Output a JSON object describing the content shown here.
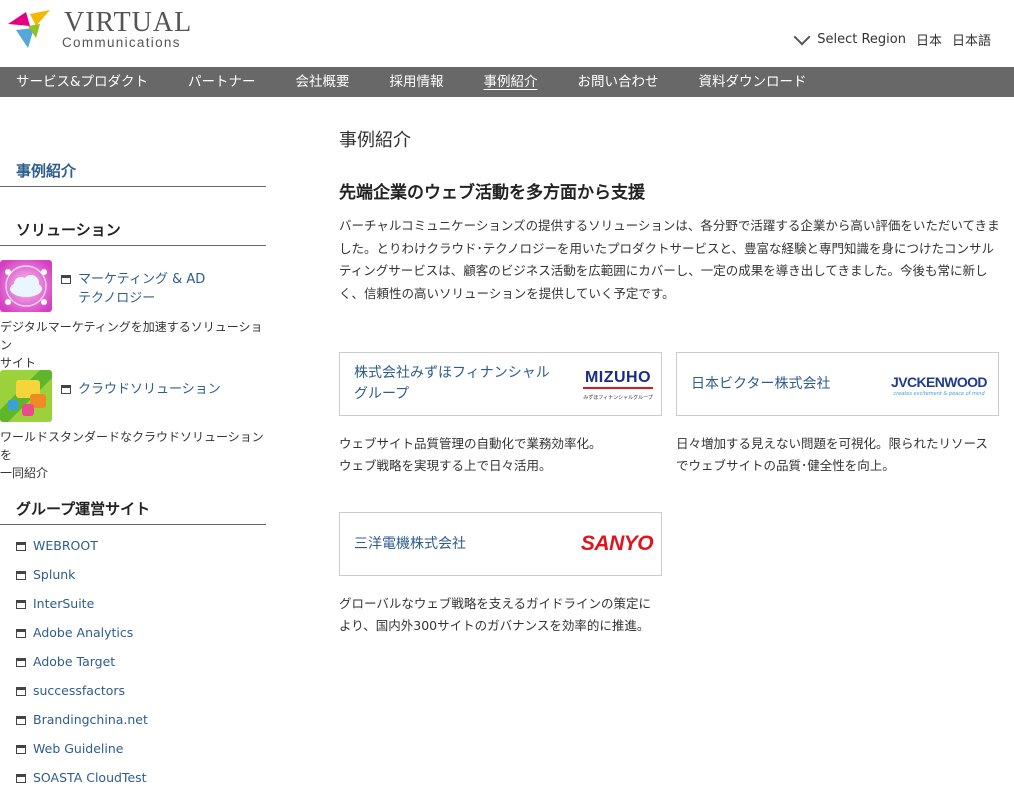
{
  "brand": {
    "name": "VIRTUAL",
    "sub": "Communications"
  },
  "region": {
    "label": "Select Region",
    "links": [
      "日本",
      "日本語"
    ]
  },
  "nav": [
    {
      "label": "サービス&プロダクト"
    },
    {
      "label": "パートナー"
    },
    {
      "label": "会社概要"
    },
    {
      "label": "採用情報"
    },
    {
      "label": "事例紹介",
      "active": true
    },
    {
      "label": "お問い合わせ"
    },
    {
      "label": "資料ダウンロード"
    }
  ],
  "sidebar": {
    "cases_heading": "事例紹介",
    "solutions_heading": "ソリューション",
    "solutions": [
      {
        "title_line1": "マーケティング & AD",
        "title_line2": "テクノロジー",
        "desc_line1": "デジタルマーケティングを加速するソリューション",
        "desc_line2": "サイト"
      },
      {
        "title_line1": "クラウドソリューション",
        "desc_line1": "ワールドスタンダードなクラウドソリューションを",
        "desc_line2": "一同紹介"
      }
    ],
    "group_heading": "グループ運営サイト",
    "group_sites": [
      "WEBROOT",
      "Splunk",
      "InterSuite",
      "Adobe Analytics",
      "Adobe Target",
      "successfactors",
      "Brandingchina.net",
      "Web Guideline",
      "SOASTA CloudTest"
    ]
  },
  "main": {
    "page_title": "事例紹介",
    "lead_title": "先端企業のウェブ活動を多方面から支援",
    "lead_text": "バーチャルコミュニケーションズの提供するソリューションは、各分野で活躍する企業から高い評価をいただいてきました。とりわけクラウド･テクノロジーを用いたプロダクトサービスと、豊富な経験と専門知識を身につけたコンサルティングサービスは、顧客のビジネス活動を広範囲にカバーし、一定の成果を導き出してきました。今後も常に新しく、信頼性の高いソリューションを提供していく予定です。",
    "cases": [
      {
        "name_line1": "株式会社みずほフィナンシャル",
        "name_line2": "グループ",
        "logo_text": "MIZUHO",
        "logo_sub": "みずほフィナンシャルグループ",
        "desc_line1": "ウェブサイト品質管理の自動化で業務効率化。",
        "desc_line2": "ウェブ戦略を実現する上で日々活用。"
      },
      {
        "name_line1": "日本ビクター株式会社",
        "logo_text": "JVCKENWOOD",
        "logo_sub": "creates excitement & peace of mind",
        "desc_line1": "日々増加する見えない問題を可視化。限られたリソース",
        "desc_line2": "でウェブサイトの品質･健全性を向上。"
      },
      {
        "name_line1": "三洋電機株式会社",
        "logo_text": "SANYO",
        "desc_line1": "グローバルなウェブ戦略を支えるガイドラインの策定に",
        "desc_line2": "より、国内外300サイトのガバナンスを効率的に推進。"
      }
    ]
  },
  "colors": {
    "link": "#2d5d8c",
    "nav_bg": "#686868",
    "sanyo_red": "#e0141e",
    "mizuho_blue": "#1a2d80",
    "jvc_blue": "#1f3c8c"
  }
}
